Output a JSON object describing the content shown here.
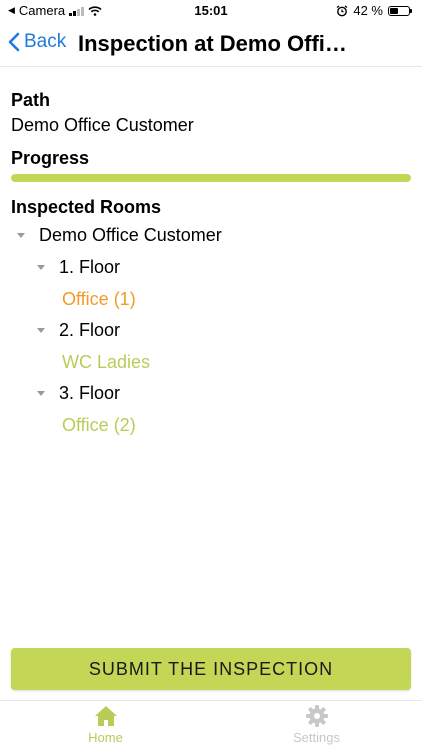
{
  "status_bar": {
    "carrier": "Camera",
    "time": "15:01",
    "battery": "42 %"
  },
  "nav": {
    "back_label": "Back",
    "title": "Inspection at Demo Office Customer"
  },
  "details": {
    "path_label": "Path",
    "path_value": "Demo Office Customer",
    "progress_label": "Progress",
    "progress_fraction": 1.0,
    "rooms_label": "Inspected Rooms"
  },
  "tree": {
    "root": "Demo Office Customer",
    "floors": [
      {
        "name": "1. Floor",
        "room": "Office (1)",
        "room_color": "#f39a2a"
      },
      {
        "name": "2. Floor",
        "room": "WC Ladies",
        "room_color": "#b9cc5a"
      },
      {
        "name": "3. Floor",
        "room": "Office (2)",
        "room_color": "#b9cc5a"
      }
    ]
  },
  "actions": {
    "submit_label": "SUBMIT THE INSPECTION"
  },
  "tabs": {
    "home_label": "Home",
    "settings_label": "Settings"
  },
  "colors": {
    "accent": "#c3d656",
    "link": "#1e7be0",
    "pending": "#f39a2a"
  }
}
